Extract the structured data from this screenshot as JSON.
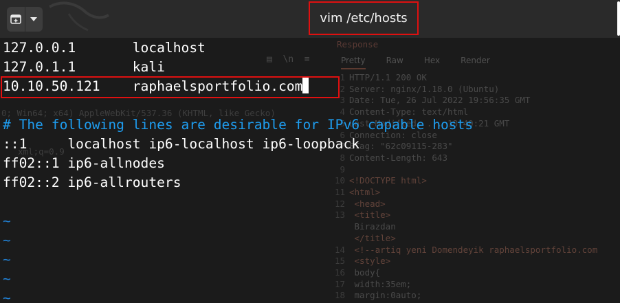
{
  "window": {
    "title": "vim /etc/hosts"
  },
  "hosts": {
    "lines": [
      "127.0.0.1       localhost",
      "127.0.1.1       kali",
      "10.10.50.121    raphaelsportfolio.com",
      "",
      "# The following lines are desirable for IPv6 capable hosts",
      "::1     localhost ip6-localhost ip6-loopback",
      "ff02::1 ip6-allnodes",
      "ff02::2 ip6-allrouters"
    ],
    "tilde": "~"
  },
  "background_window": {
    "section_title": "Response",
    "tabs": [
      "Pretty",
      "Raw",
      "Hex",
      "Render"
    ],
    "left_fragments": [
      "0; Win64; x64) AppleWebKit/537.36 (KHTML, like Gecko)",
      "xml;q=0.9"
    ],
    "response_lines": [
      {
        "num": "1",
        "text": "HTTP/1.1 200 OK"
      },
      {
        "num": "2",
        "text": "Server: nginx/1.18.0 (Ubuntu)"
      },
      {
        "num": "3",
        "text": "Date: Tue, 26 Jul 2022 19:56:35 GMT"
      },
      {
        "num": "4",
        "text": "Content-Type: text/html"
      },
      {
        "num": "5",
        "text": "Last-Modified: ... 18:40:21 GMT"
      },
      {
        "num": "6",
        "text": "Connection: close"
      },
      {
        "num": "7",
        "text": "ETag: \"62c09115-283\""
      },
      {
        "num": "8",
        "text": "Content-Length: 643"
      },
      {
        "num": "9",
        "text": ""
      },
      {
        "num": "10",
        "text": "<!DOCTYPE html>"
      },
      {
        "num": "11",
        "text": "<html>"
      },
      {
        "num": "12",
        "text": "  <head>"
      },
      {
        "num": "13",
        "text": "    <title>"
      },
      {
        "num": "",
        "text": "      Birazdan"
      },
      {
        "num": "",
        "text": "    </title>"
      },
      {
        "num": "14",
        "text": "    <!--artiq yeni Domendeyik raphaelsportfolio.com"
      },
      {
        "num": "15",
        "text": "    <style>"
      },
      {
        "num": "16",
        "text": "      body{"
      },
      {
        "num": "17",
        "text": "        width:35em;"
      },
      {
        "num": "18",
        "text": "        margin:0auto;"
      }
    ]
  }
}
